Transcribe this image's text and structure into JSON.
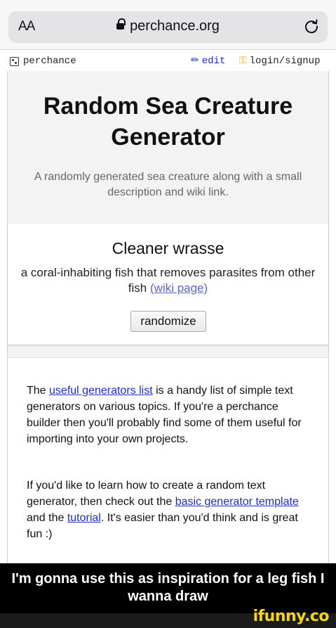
{
  "browser": {
    "text_size_label": "AA",
    "url": "perchance.org"
  },
  "topbar": {
    "brand": "perchance",
    "edit": "edit",
    "login": "login/signup"
  },
  "page": {
    "title": "Random Sea Creature Generator",
    "description": "A randomly generated sea creature along with a small description and wiki link."
  },
  "result": {
    "name": "Cleaner wrasse",
    "description": "a coral-inhabiting fish that removes parasites from other fish",
    "wiki_link": "(wiki page)",
    "button": "randomize"
  },
  "info": {
    "p1_before": "The ",
    "p1_link": "useful generators list",
    "p1_after": " is a handy list of simple text generators on various topics. If you're a perchance builder then you'll probably find some of them useful for importing into your own projects.",
    "p2_before": "If you'd like to learn how to create a random text generator, then check out the ",
    "p2_link1": "basic generator template",
    "p2_mid": " and the ",
    "p2_link2": "tutorial",
    "p2_after": ". It's easier than you'd think and is great fun :)"
  },
  "caption": {
    "text": "I'm gonna use this as inspiration for a leg fish I wanna draw"
  },
  "watermark": {
    "text": "ifunny.co"
  },
  "icons": {
    "lock": "lock-icon",
    "reload": "reload-icon",
    "dice": "dice-icon",
    "pencil": "pencil-icon",
    "key": "key-icon"
  },
  "colors": {
    "link": "#1e2bd1",
    "wiki_link": "#5d63c9",
    "watermark": "#f5d31a"
  }
}
